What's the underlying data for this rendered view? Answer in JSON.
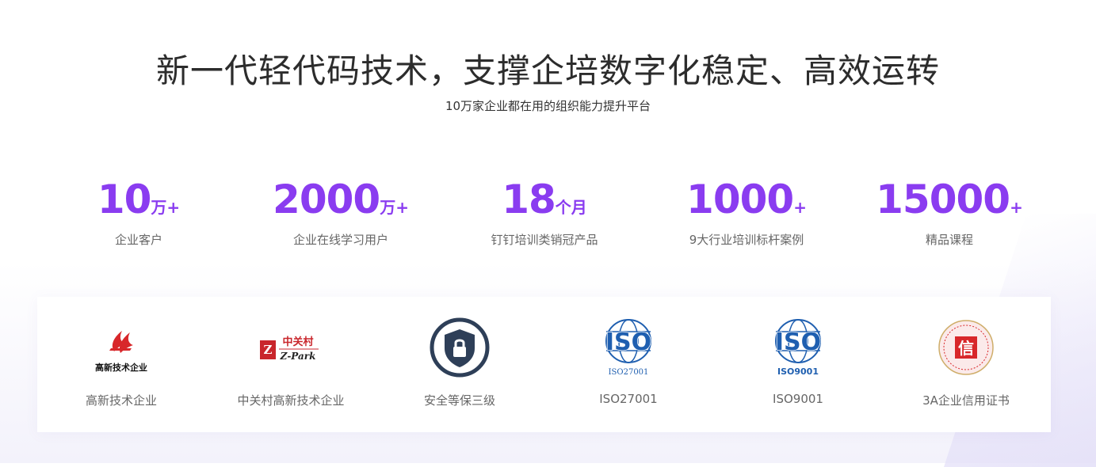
{
  "header": {
    "title": "新一代轻代码技术，支撑企培数字化稳定、高效运转",
    "subtitle": "10万家企业都在用的组织能力提升平台"
  },
  "stats": [
    {
      "number": "10",
      "unit": "万+",
      "label": "企业客户"
    },
    {
      "number": "2000",
      "unit": "万+",
      "label": "企业在线学习用户"
    },
    {
      "number": "18",
      "unit": "个月",
      "label": "钉钉培训类销冠产品"
    },
    {
      "number": "1000",
      "unit": "+",
      "label": "9大行业培训标杆案例"
    },
    {
      "number": "15000",
      "unit": "+",
      "label": "精品课程"
    }
  ],
  "certifications": [
    {
      "label": "高新技术企业",
      "icon": "high-tech-enterprise-logo",
      "logo_text": "高新技术企业"
    },
    {
      "label": "中关村高新技术企业",
      "icon": "zpark-logo",
      "logo_text": "中关村",
      "logo_sub": "Z-Park"
    },
    {
      "label": "安全等保三级",
      "icon": "security-shield-icon"
    },
    {
      "label": "ISO27001",
      "icon": "iso-globe-logo",
      "logo_text": "ISO",
      "logo_sub": "ISO27001"
    },
    {
      "label": "ISO9001",
      "icon": "iso-globe-logo",
      "logo_text": "ISO",
      "logo_sub": "ISO9001"
    },
    {
      "label": "3A企业信用证书",
      "icon": "credit-seal-logo",
      "logo_text": "信"
    }
  ],
  "colors": {
    "accent": "#8a3cf0",
    "iso_blue": "#1f5fb0",
    "red": "#d8272a",
    "shield": "#2e3f58"
  }
}
